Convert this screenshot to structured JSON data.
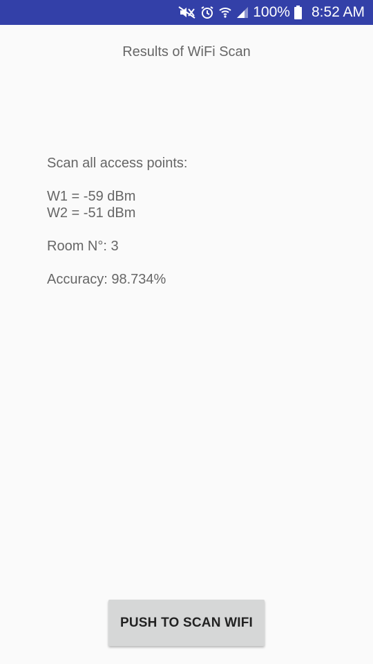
{
  "status_bar": {
    "battery_text": "100%",
    "time": "8:52 AM",
    "background_color": "#3340a8",
    "icons": [
      "mute-icon",
      "alarm-icon",
      "wifi-icon",
      "signal-icon",
      "battery-icon"
    ]
  },
  "screen": {
    "title": "Results of WiFi Scan"
  },
  "results": {
    "heading": "Scan all access points:",
    "readings": [
      "W1 = -59 dBm",
      "W2 = -51 dBm"
    ],
    "room": "Room N°: 3",
    "accuracy": "Accuracy: 98.734%"
  },
  "actions": {
    "scan_button_label": "PUSH TO SCAN WIFI"
  }
}
